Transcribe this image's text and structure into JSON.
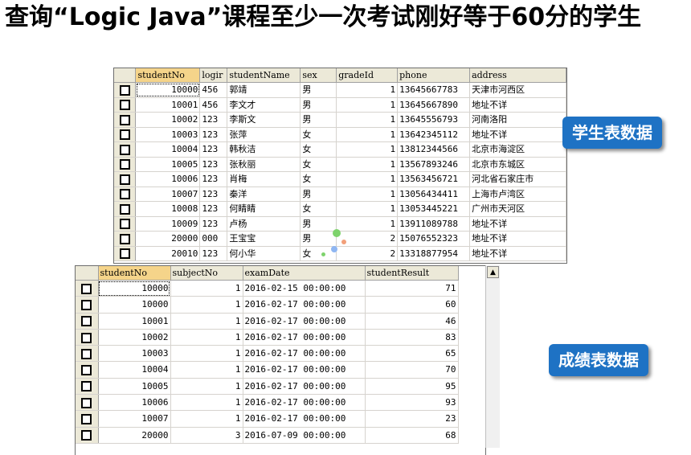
{
  "title": "查询“Logic Java”课程至少一次考试刚好等于60分的学生",
  "student_table": {
    "columns": [
      "studentNo",
      "logir",
      "studentName",
      "sex",
      "gradeId",
      "phone",
      "address"
    ],
    "rows": [
      [
        "10000",
        "456",
        "郭靖",
        "男",
        "1",
        "13645667783",
        "天津市河西区"
      ],
      [
        "10001",
        "456",
        "李文才",
        "男",
        "1",
        "13645667890",
        "地址不详"
      ],
      [
        "10002",
        "123",
        "李斯文",
        "男",
        "1",
        "13645556793",
        "河南洛阳"
      ],
      [
        "10003",
        "123",
        "张萍",
        "女",
        "1",
        "13642345112",
        "地址不详"
      ],
      [
        "10004",
        "123",
        "韩秋洁",
        "女",
        "1",
        "13812344566",
        "北京市海淀区"
      ],
      [
        "10005",
        "123",
        "张秋丽",
        "女",
        "1",
        "13567893246",
        "北京市东城区"
      ],
      [
        "10006",
        "123",
        "肖梅",
        "女",
        "1",
        "13563456721",
        "河北省石家庄市"
      ],
      [
        "10007",
        "123",
        "秦洋",
        "男",
        "1",
        "13056434411",
        "上海市卢湾区"
      ],
      [
        "10008",
        "123",
        "何睛睛",
        "女",
        "1",
        "13053445221",
        "广州市天河区"
      ],
      [
        "10009",
        "123",
        "卢杨",
        "男",
        "1",
        "13911089788",
        "地址不详"
      ],
      [
        "20000",
        "000",
        "王宝宝",
        "男",
        "2",
        "15076552323",
        "地址不详"
      ],
      [
        "20010",
        "123",
        "何小华",
        "女",
        "2",
        "13318877954",
        "地址不详"
      ]
    ]
  },
  "result_table": {
    "columns": [
      "studentNo",
      "subjectNo",
      "examDate",
      "studentResult"
    ],
    "rows": [
      [
        "10000",
        "1",
        "2016-02-15 00:00:00",
        "71"
      ],
      [
        "10000",
        "1",
        "2016-02-17 00:00:00",
        "60"
      ],
      [
        "10001",
        "1",
        "2016-02-17 00:00:00",
        "46"
      ],
      [
        "10002",
        "1",
        "2016-02-17 00:00:00",
        "83"
      ],
      [
        "10003",
        "1",
        "2016-02-17 00:00:00",
        "65"
      ],
      [
        "10004",
        "1",
        "2016-02-17 00:00:00",
        "70"
      ],
      [
        "10005",
        "1",
        "2016-02-17 00:00:00",
        "95"
      ],
      [
        "10006",
        "1",
        "2016-02-17 00:00:00",
        "93"
      ],
      [
        "10007",
        "1",
        "2016-02-17 00:00:00",
        "23"
      ],
      [
        "20000",
        "3",
        "2016-07-09 00:00:00",
        "68"
      ]
    ]
  },
  "labels": {
    "student_badge": "学生表数据",
    "result_badge": "成绩表数据"
  },
  "colors": {
    "badge": "#1e72c4",
    "header": "#ece9d8",
    "selected_header": "#f5d48a"
  }
}
